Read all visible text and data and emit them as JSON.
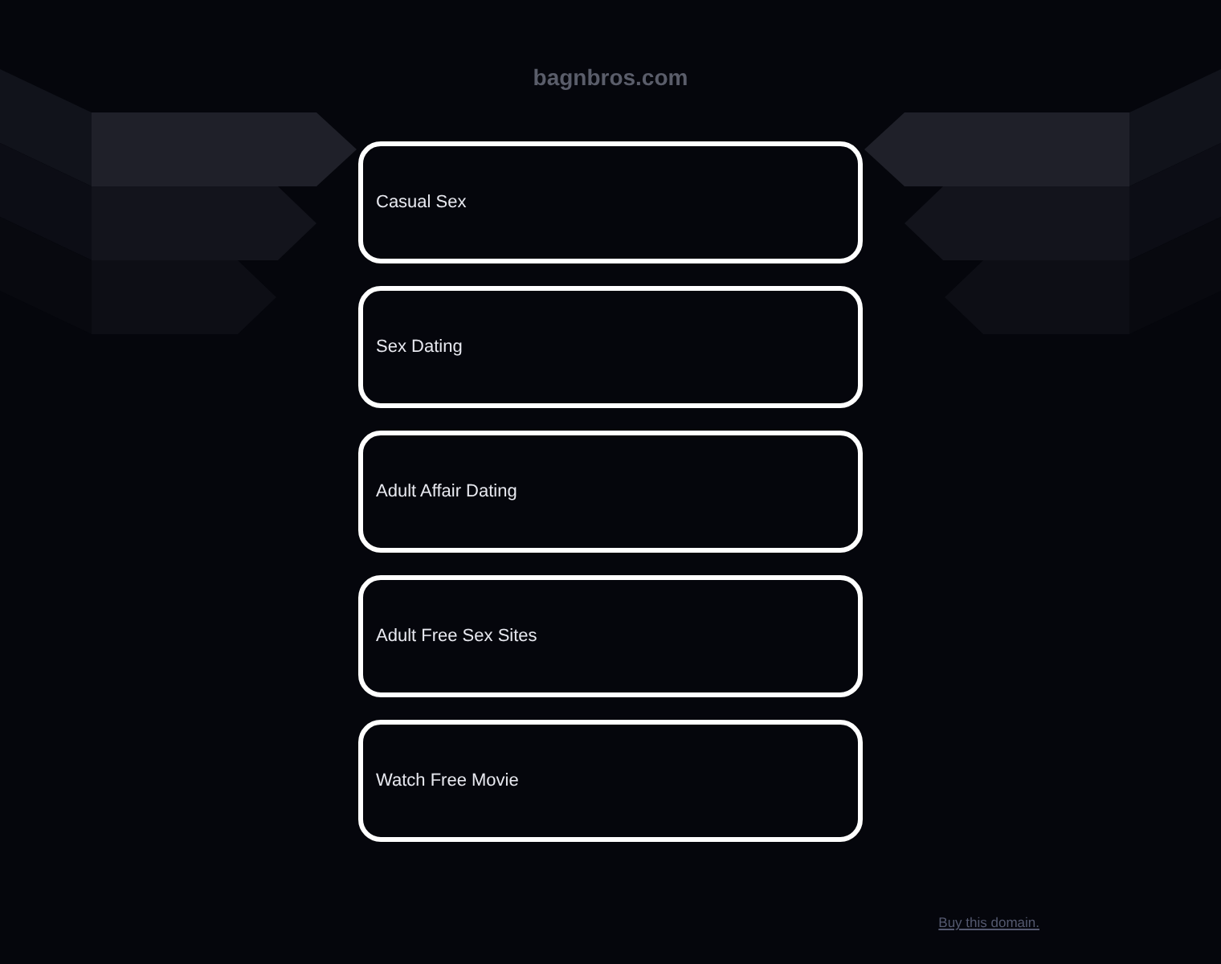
{
  "header": {
    "domain": "bagnbros.com"
  },
  "links": [
    {
      "label": "Casual Sex"
    },
    {
      "label": "Sex Dating"
    },
    {
      "label": "Adult Affair Dating"
    },
    {
      "label": "Adult Free Sex Sites"
    },
    {
      "label": "Watch Free Movie"
    }
  ],
  "footer": {
    "link": "Buy this domain."
  }
}
